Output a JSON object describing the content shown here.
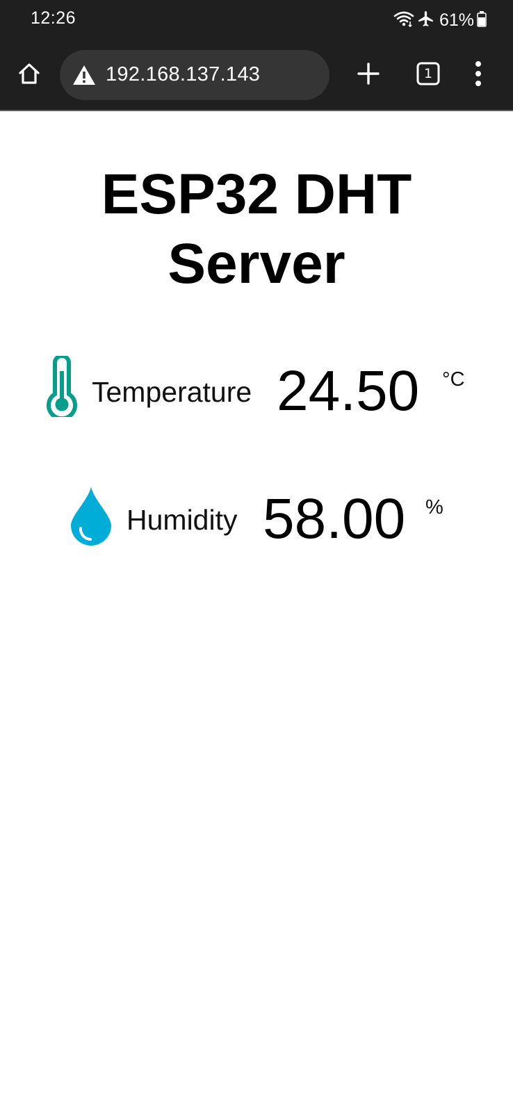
{
  "status_bar": {
    "time": "12:26",
    "battery": "61%",
    "icons": [
      "wifi-icon",
      "airplane-icon",
      "battery-icon"
    ]
  },
  "browser": {
    "url": "192.168.137.143",
    "tab_count": "1",
    "icons": [
      "home-icon",
      "warning-icon",
      "plus-icon",
      "tabs-icon",
      "more-vert-icon"
    ]
  },
  "page": {
    "title": "ESP32 DHT Server",
    "sensors": [
      {
        "label": "Temperature",
        "value": "24.50",
        "unit": "°C",
        "icon": "thermometer-icon",
        "color": "#059e8a"
      },
      {
        "label": "Humidity",
        "value": "58.00",
        "unit": "%",
        "icon": "droplet-icon",
        "color": "#00add6"
      }
    ]
  }
}
